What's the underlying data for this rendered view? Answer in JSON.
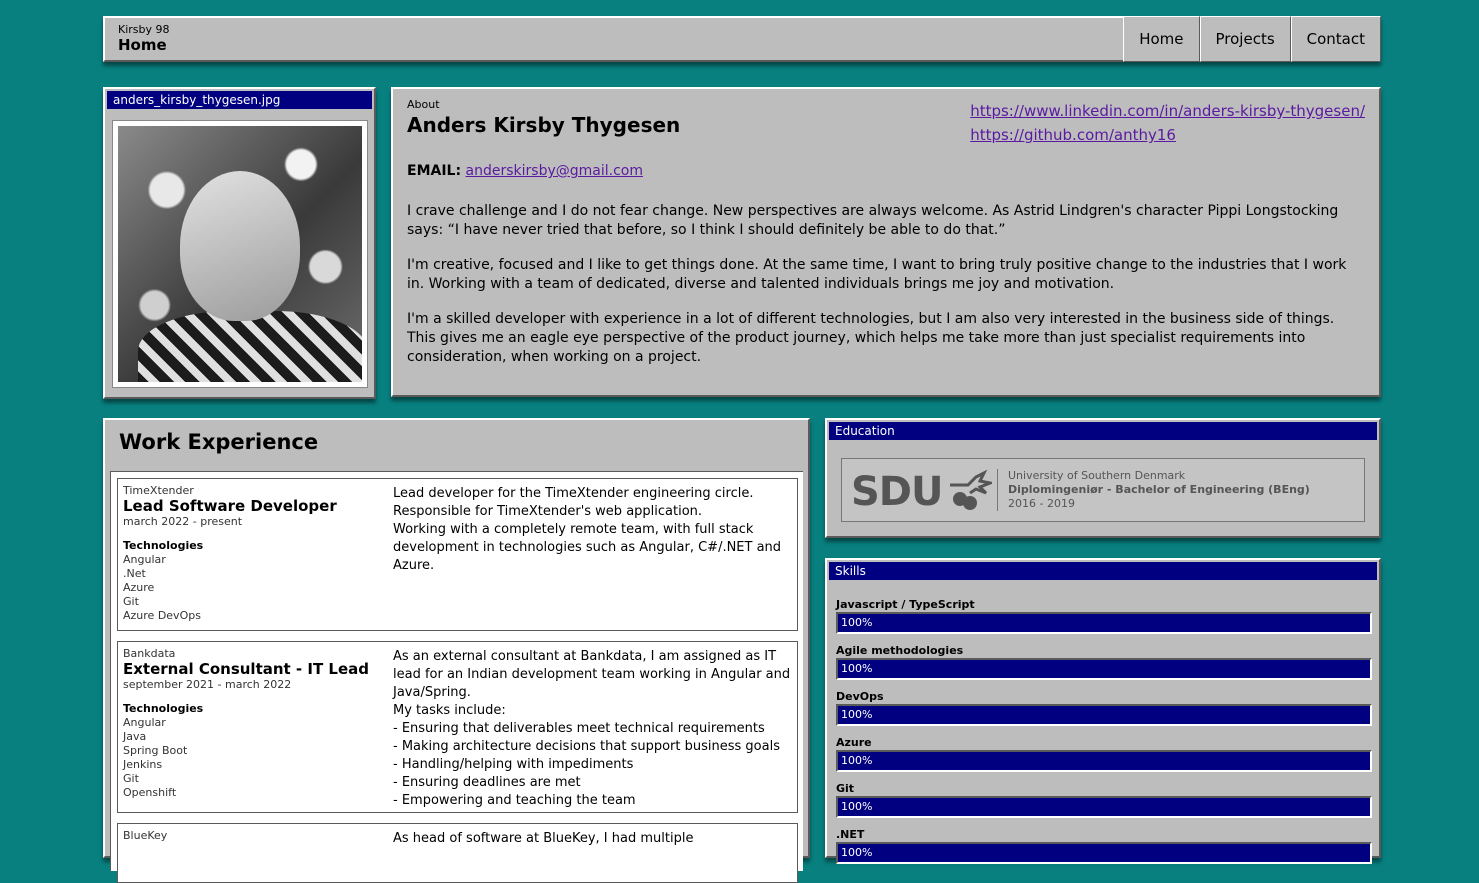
{
  "header": {
    "brand_small": "Kirsby 98",
    "page_title": "Home",
    "nav": [
      "Home",
      "Projects",
      "Contact"
    ]
  },
  "photo": {
    "title": "anders_kirsby_thygesen.jpg"
  },
  "about": {
    "label": "About",
    "name": "Anders Kirsby Thygesen",
    "links": [
      "https://www.linkedin.com/in/anders-kirsby-thygesen/",
      "https://github.com/anthy16"
    ],
    "email_label": "EMAIL:",
    "email": "anderskirsby@gmail.com",
    "paragraphs": [
      "I crave challenge and I do not fear change. New perspectives are always welcome. As Astrid Lindgren's character Pippi Longstocking says: “I have never tried that before, so I think I should definitely be able to do that.”",
      "I'm creative, focused and I like to get things done. At the same time, I want to bring truly positive change to the industries that I work in. Working with a team of dedicated, diverse and talented individuals brings me joy and motivation.",
      "I'm a skilled developer with experience in a lot of different technologies, but I am also very interested in the business side of things. This gives me an eagle eye perspective of the product journey, which helps me take more than just specialist requirements into consideration, when working on a project."
    ]
  },
  "work": {
    "title": "Work Experience",
    "tech_heading": "Technologies",
    "jobs": [
      {
        "company": "TimeXtender",
        "role": "Lead Software Developer",
        "period": "march 2022 - present",
        "technologies": [
          "Angular",
          ".Net",
          "Azure",
          "Git",
          "Azure DevOps"
        ],
        "description": [
          "Lead developer for the TimeXtender engineering circle.",
          "Responsible for TimeXtender's web application.",
          "Working with a completely remote team, with full stack development in technologies such as Angular, C#/.NET and Azure."
        ]
      },
      {
        "company": "Bankdata",
        "role": "External Consultant - IT Lead",
        "period": "september 2021 - march 2022",
        "technologies": [
          "Angular",
          "Java",
          "Spring Boot",
          "Jenkins",
          "Git",
          "Openshift"
        ],
        "description": [
          "As an external consultant at Bankdata, I am assigned as IT lead for an Indian development team working in Angular and Java/Spring.",
          "My tasks include:",
          "- Ensuring that deliverables meet technical requirements",
          "- Making architecture decisions that support business goals",
          "- Handling/helping with impediments",
          "- Ensuring deadlines are met",
          "- Empowering and teaching the team"
        ]
      },
      {
        "company": "BlueKey",
        "role": "",
        "period": "",
        "technologies": [],
        "description": [
          "As head of software at BlueKey, I had multiple"
        ]
      }
    ]
  },
  "education": {
    "title": "Education",
    "logo_text": "SDU",
    "university": "University of Southern Denmark",
    "degree": "Diplomingeniør - Bachelor of Engineering (BEng)",
    "years": "2016 - 2019"
  },
  "skills": {
    "title": "Skills",
    "items": [
      {
        "name": "Javascript / TypeScript",
        "level": 100,
        "label": "100%"
      },
      {
        "name": "Agile methodologies",
        "level": 100,
        "label": "100%"
      },
      {
        "name": "DevOps",
        "level": 100,
        "label": "100%"
      },
      {
        "name": "Azure",
        "level": 100,
        "label": "100%"
      },
      {
        "name": "Git",
        "level": 100,
        "label": "100%"
      },
      {
        "name": ".NET",
        "level": 100,
        "label": "100%"
      }
    ]
  }
}
